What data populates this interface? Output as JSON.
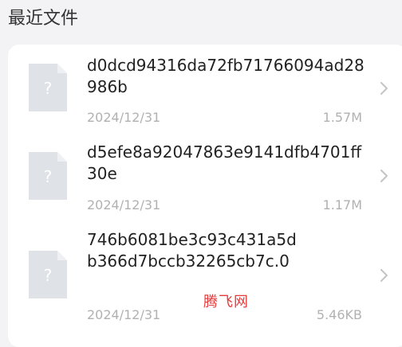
{
  "section": {
    "title": "最近文件"
  },
  "files": [
    {
      "name": "d0dcd94316da72fb71766094ad28986b",
      "date": "2024/12/31",
      "size": "1.57M",
      "icon": "unknown-file-icon"
    },
    {
      "name": "d5efe8a92047863e9141dfb4701ff30e",
      "date": "2024/12/31",
      "size": "1.17M",
      "icon": "unknown-file-icon"
    },
    {
      "name": "746b6081be3c93c431a5db366d7bccb32265cb7c.0",
      "date": "2024/12/31",
      "size": "5.46KB",
      "icon": "unknown-file-icon"
    }
  ],
  "watermark": {
    "text": "腾飞网"
  },
  "colors": {
    "background": "#f3f3f5",
    "card": "#ffffff",
    "thumb": "#dfe2e6",
    "thumb_fold": "#eef0f3",
    "meta_text": "#b1b1b1",
    "watermark": "#e63a3a"
  }
}
